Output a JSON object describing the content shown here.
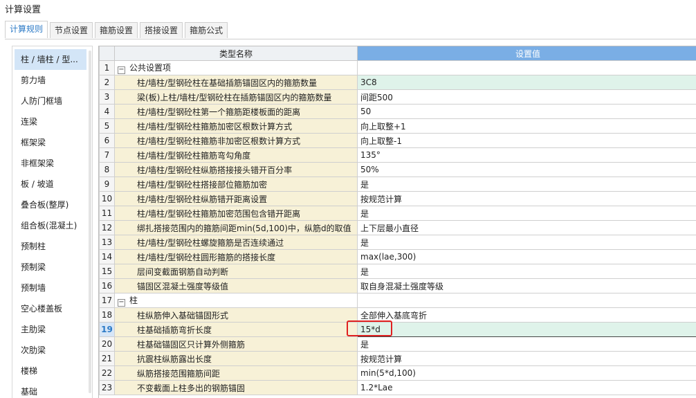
{
  "window": {
    "title": "计算设置"
  },
  "tabs": [
    {
      "label": "计算规则",
      "active": true
    },
    {
      "label": "节点设置",
      "active": false
    },
    {
      "label": "箍筋设置",
      "active": false
    },
    {
      "label": "搭接设置",
      "active": false
    },
    {
      "label": "箍筋公式",
      "active": false
    }
  ],
  "sidebar": {
    "items": [
      {
        "label": "柱 / 墙柱 / 型...",
        "selected": true
      },
      {
        "label": "剪力墙"
      },
      {
        "label": "人防门框墙"
      },
      {
        "label": "连梁"
      },
      {
        "label": "框架梁"
      },
      {
        "label": "非框架梁"
      },
      {
        "label": "板 / 坡道"
      },
      {
        "label": "叠合板(整厚)"
      },
      {
        "label": "组合板(混凝土)"
      },
      {
        "label": "预制柱"
      },
      {
        "label": "预制梁"
      },
      {
        "label": "预制墙"
      },
      {
        "label": "空心楼盖板"
      },
      {
        "label": "主肋梁"
      },
      {
        "label": "次肋梁"
      },
      {
        "label": "楼梯"
      },
      {
        "label": "基础"
      }
    ]
  },
  "table": {
    "headers": {
      "name": "类型名称",
      "value": "设置值"
    },
    "expander_symbol": "−",
    "rows": [
      {
        "num": "1",
        "group": true,
        "name": "公共设置项",
        "value": ""
      },
      {
        "num": "2",
        "name": "柱/墙柱/型钢砼柱在基础插筋锚固区内的箍筋数量",
        "value": "3C8",
        "highlight": true
      },
      {
        "num": "3",
        "name": "梁(板)上柱/墙柱/型钢砼柱在插筋锚固区内的箍筋数量",
        "value": "间距500"
      },
      {
        "num": "4",
        "name": "柱/墙柱/型钢砼柱第一个箍筋距楼板面的距离",
        "value": "50"
      },
      {
        "num": "5",
        "name": "柱/墙柱/型钢砼柱箍筋加密区根数计算方式",
        "value": "向上取整+1"
      },
      {
        "num": "6",
        "name": "柱/墙柱/型钢砼柱箍筋非加密区根数计算方式",
        "value": "向上取整-1"
      },
      {
        "num": "7",
        "name": "柱/墙柱/型钢砼柱箍筋弯勾角度",
        "value": "135°"
      },
      {
        "num": "8",
        "name": "柱/墙柱/型钢砼柱纵筋搭接接头错开百分率",
        "value": "50%"
      },
      {
        "num": "9",
        "name": "柱/墙柱/型钢砼柱搭接部位箍筋加密",
        "value": "是"
      },
      {
        "num": "10",
        "name": "柱/墙柱/型钢砼柱纵筋错开距离设置",
        "value": "按规范计算"
      },
      {
        "num": "11",
        "name": "柱/墙柱/型钢砼柱箍筋加密范围包含错开距离",
        "value": "是"
      },
      {
        "num": "12",
        "name": "绑扎搭接范围内的箍筋间距min(5d,100)中，纵筋d的取值",
        "value": "上下层最小直径"
      },
      {
        "num": "13",
        "name": "柱/墙柱/型钢砼柱螺旋箍筋是否连续通过",
        "value": "是"
      },
      {
        "num": "14",
        "name": "柱/墙柱/型钢砼柱圆形箍筋的搭接长度",
        "value": "max(lae,300)"
      },
      {
        "num": "15",
        "name": "层间变截面钢筋自动判断",
        "value": "是"
      },
      {
        "num": "16",
        "name": "锚固区混凝土强度等级值",
        "value": "取自身混凝土强度等级"
      },
      {
        "num": "17",
        "group": true,
        "name": "柱",
        "value": ""
      },
      {
        "num": "18",
        "name": "柱纵筋伸入基础锚固形式",
        "value": "全部伸入基底弯折"
      },
      {
        "num": "19",
        "name": "柱基础插筋弯折长度",
        "value": "15*d",
        "current": true
      },
      {
        "num": "20",
        "name": "柱基础锚固区只计算外侧箍筋",
        "value": "是"
      },
      {
        "num": "21",
        "name": "抗震柱纵筋露出长度",
        "value": "按规范计算"
      },
      {
        "num": "22",
        "name": "纵筋搭接范围箍筋间距",
        "value": "min(5*d,100)"
      },
      {
        "num": "23",
        "name": "不变截面上柱多出的钢筋锚固",
        "value": "1.2*Lae"
      }
    ]
  },
  "colors": {
    "accent": "#2c7ac6",
    "header_value_bg": "#7aaee5",
    "name_cell_bg": "#f7f1d7",
    "highlight_bg": "#dff3ea",
    "annotation_red": "#e02020"
  }
}
